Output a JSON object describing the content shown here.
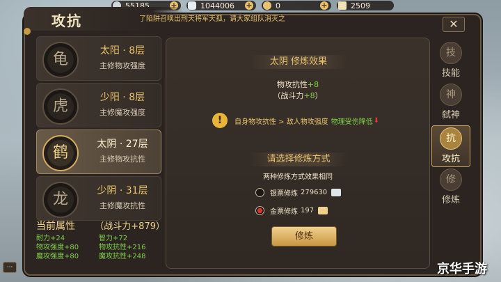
{
  "topbar": {
    "resources": [
      {
        "icon": "silver-coin-icon",
        "value": "55185"
      },
      {
        "icon": "silver-ingot-icon",
        "value": "1044006"
      },
      {
        "icon": "gold-coin-icon",
        "value": "0"
      },
      {
        "icon": "scroll-icon",
        "value": "2509"
      }
    ],
    "plus_label": "+"
  },
  "header": {
    "title": "攻抗",
    "notice": "了陷阱召唤出刑天将军天孤，请大家组队消灭之",
    "close_label": "✕"
  },
  "list": {
    "items": [
      {
        "name": "太阳 · 8层",
        "sub": "主修物攻强度",
        "emblem": "龟"
      },
      {
        "name": "少阳 · 8层",
        "sub": "主修魔攻强度",
        "emblem": "虎"
      },
      {
        "name": "太阴 · 27层",
        "sub": "主修物攻抗性",
        "emblem": "鹤"
      },
      {
        "name": "少阴 · 31层",
        "sub": "主修魔攻抗性",
        "emblem": "龙"
      }
    ],
    "active_index": 2
  },
  "attributes": {
    "title": "当前属性",
    "power": "（战斗力+879）",
    "stats": [
      "耐力+24",
      "智力+72",
      "物攻强度+80",
      "物攻抗性+216",
      "魔攻强度+80",
      "魔攻抗性+248"
    ]
  },
  "effect": {
    "header": "太阴 修炼效果",
    "stat_label": "物攻抗性",
    "stat_value": "+8",
    "power_label": "（战斗力",
    "power_value": "+8",
    "power_close": "）",
    "info_text": "自身物攻抗性 > 敌人物攻强度",
    "info_note": "物理受伤降低",
    "info_arrow": "⬇",
    "info_icon": "!"
  },
  "method": {
    "header": "请选择修炼方式",
    "hint": "两种修炼方式效果相同",
    "options": [
      {
        "label": "银票修炼",
        "amount": "279630",
        "selected": false
      },
      {
        "label": "金票修炼",
        "amount": "197",
        "selected": true
      }
    ],
    "button": "修炼"
  },
  "right_tabs": [
    {
      "label": "技能",
      "icon": "技"
    },
    {
      "label": "弑神",
      "icon": "神"
    },
    {
      "label": "攻抗",
      "icon": "抗"
    },
    {
      "label": "修炼",
      "icon": "修"
    }
  ],
  "active_tab": 2,
  "chat_label": "···",
  "watermark": "京华手游",
  "colors": {
    "accent": "#e9c36b",
    "green": "#7fd14b",
    "panel": "#2b2420"
  }
}
